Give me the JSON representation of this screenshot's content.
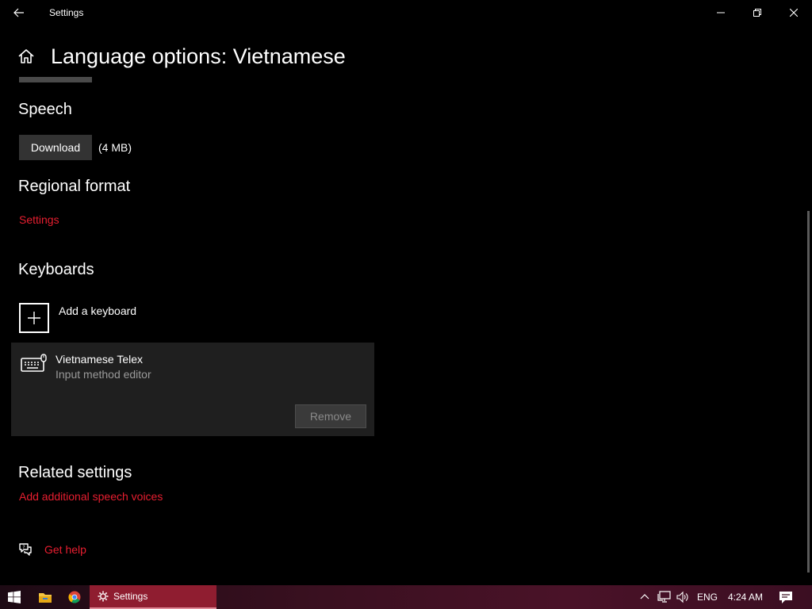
{
  "window": {
    "app_title": "Settings"
  },
  "page": {
    "title": "Language options: Vietnamese"
  },
  "speech": {
    "heading": "Speech",
    "download_label": "Download",
    "size": "(4 MB)"
  },
  "regional_format": {
    "heading": "Regional format",
    "settings_link": "Settings"
  },
  "keyboards": {
    "heading": "Keyboards",
    "add_label": "Add a keyboard",
    "items": [
      {
        "name": "Vietnamese Telex",
        "subtitle": "Input method editor",
        "remove_label": "Remove"
      }
    ]
  },
  "related": {
    "heading": "Related settings",
    "speech_voices_link": "Add additional speech voices"
  },
  "help": {
    "label": "Get help"
  },
  "taskbar": {
    "active_app_label": "Settings",
    "language": "ENG",
    "time": "4:24 AM"
  },
  "colors": {
    "accent_link": "#e81e30",
    "taskbar_active": "#8f1d30",
    "card_bg": "#1f1f1f"
  }
}
